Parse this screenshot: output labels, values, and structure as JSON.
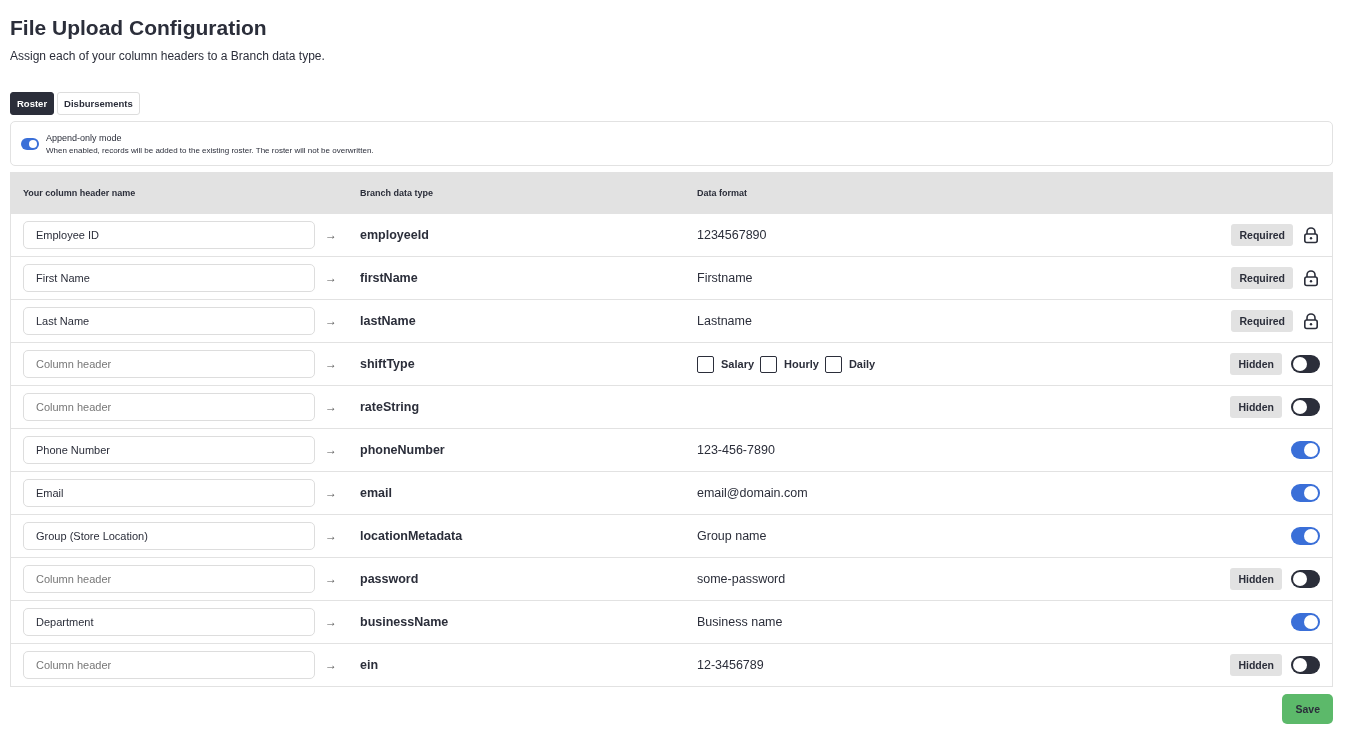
{
  "page": {
    "title": "File Upload Configuration",
    "subtitle": "Assign each of your column headers to a Branch data type."
  },
  "tabs": [
    {
      "label": "Roster",
      "selected": true
    },
    {
      "label": "Disbursements",
      "selected": false
    }
  ],
  "append_mode": {
    "on": true,
    "label": "Append-only mode",
    "description": "When enabled, records will be added to the existing roster. The roster will not be overwritten."
  },
  "table": {
    "columns": [
      "Your column header name",
      "Branch data type",
      "Data format"
    ],
    "rows": [
      {
        "value": "Employee ID",
        "arrow": "→",
        "type": "employeeId",
        "format": "1234567890",
        "kind": "locked",
        "badge": "Required"
      },
      {
        "value": "First Name",
        "arrow": "→",
        "type": "firstName",
        "format": "Firstname",
        "kind": "locked",
        "badge": "Required"
      },
      {
        "value": "Last Name",
        "arrow": "→",
        "type": "lastName",
        "format": "Lastname",
        "kind": "locked",
        "badge": "Required"
      },
      {
        "placeholder": "Column header",
        "arrow": "→",
        "type": "shiftType",
        "options": [
          {
            "label": "Salary",
            "checked": false
          },
          {
            "label": "Hourly",
            "checked": false
          },
          {
            "label": "Daily",
            "checked": false
          }
        ],
        "kind": "toggle",
        "on": false,
        "badge": "Hidden"
      },
      {
        "placeholder": "Column header",
        "arrow": "→",
        "type": "rateString",
        "kind": "toggle",
        "on": false,
        "badge": "Hidden"
      },
      {
        "value": "Phone Number",
        "arrow": "→",
        "type": "phoneNumber",
        "format": "123-456-7890",
        "kind": "toggle",
        "on": true
      },
      {
        "value": "Email",
        "arrow": "→",
        "type": "email",
        "format": "email@domain.com",
        "kind": "toggle",
        "on": true
      },
      {
        "value": "Group (Store Location)",
        "arrow": "→",
        "type": "locationMetadata",
        "format": "Group name",
        "kind": "toggle",
        "on": true
      },
      {
        "placeholder": "Column header",
        "arrow": "→",
        "type": "password",
        "format": "some-password",
        "kind": "toggle",
        "on": false,
        "badge": "Hidden"
      },
      {
        "value": "Department",
        "arrow": "→",
        "type": "businessName",
        "format": "Business name",
        "kind": "toggle",
        "on": true
      },
      {
        "placeholder": "Column header",
        "arrow": "→",
        "type": "ein",
        "format": "12-3456789",
        "kind": "toggle",
        "on": false,
        "badge": "Hidden"
      }
    ]
  },
  "save_button": "Save"
}
